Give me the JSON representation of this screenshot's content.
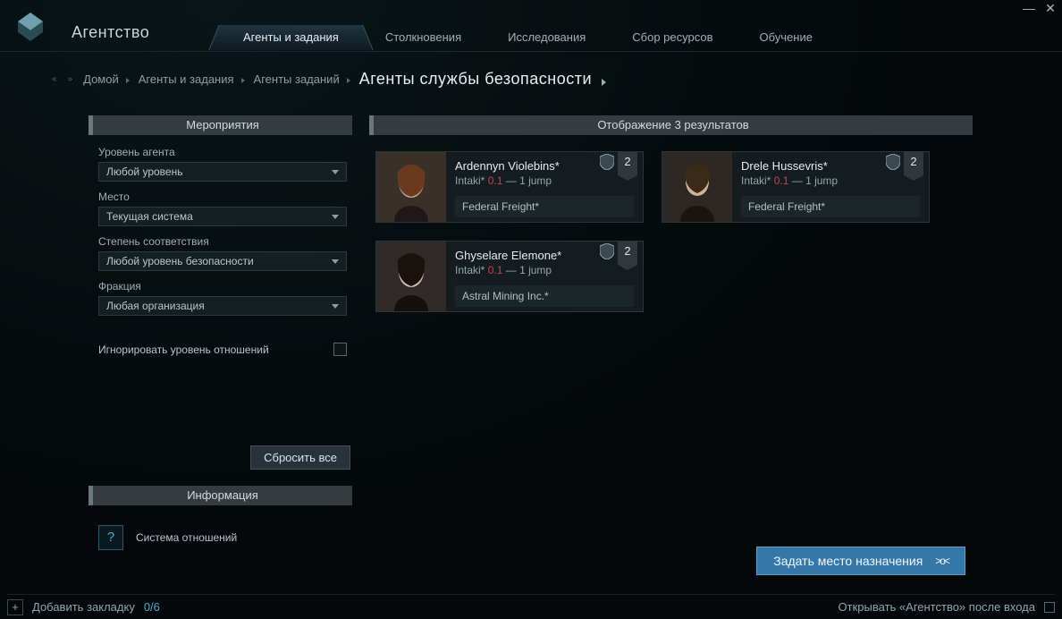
{
  "window": {
    "title": "Агентство"
  },
  "tabs": [
    {
      "label": "Агенты и задания",
      "active": true
    },
    {
      "label": "Столкновения"
    },
    {
      "label": "Исследования"
    },
    {
      "label": "Сбор ресурсов"
    },
    {
      "label": "Обучение"
    }
  ],
  "breadcrumb": {
    "home": "Домой",
    "level1": "Агенты и задания",
    "level2": "Агенты заданий",
    "page": "Агенты службы безопасности"
  },
  "filters": {
    "header": "Мероприятия",
    "agent_level_label": "Уровень агента",
    "agent_level_value": "Любой уровень",
    "location_label": "Место",
    "location_value": "Текущая система",
    "security_label": "Степень соответствия",
    "security_value": "Любой уровень безопасности",
    "faction_label": "Фракция",
    "faction_value": "Любая организация",
    "ignore_standing_label": "Игнорировать уровень отношений",
    "reset_label": "Сбросить все",
    "info_header": "Информация",
    "standings_link": "Система отношений"
  },
  "results": {
    "header": "Отображение 3 результатов",
    "agents": [
      {
        "name": "Ardennyn Violebins*",
        "system": "Intaki*",
        "sec": "0.1",
        "jumps": "1 jump",
        "corp": "Federal Freight*",
        "level": "2"
      },
      {
        "name": "Drele Hussevris*",
        "system": "Intaki*",
        "sec": "0.1",
        "jumps": "1 jump",
        "corp": "Federal Freight*",
        "level": "2"
      },
      {
        "name": "Ghyselare Elemone*",
        "system": "Intaki*",
        "sec": "0.1",
        "jumps": "1 jump",
        "corp": "Astral Mining Inc.*",
        "level": "2"
      }
    ]
  },
  "cta": {
    "label": "Задать место назначения"
  },
  "footer": {
    "add_bookmark": "Добавить закладку",
    "count": "0/6",
    "open_on_login": "Открывать «Агентство» после входа"
  }
}
